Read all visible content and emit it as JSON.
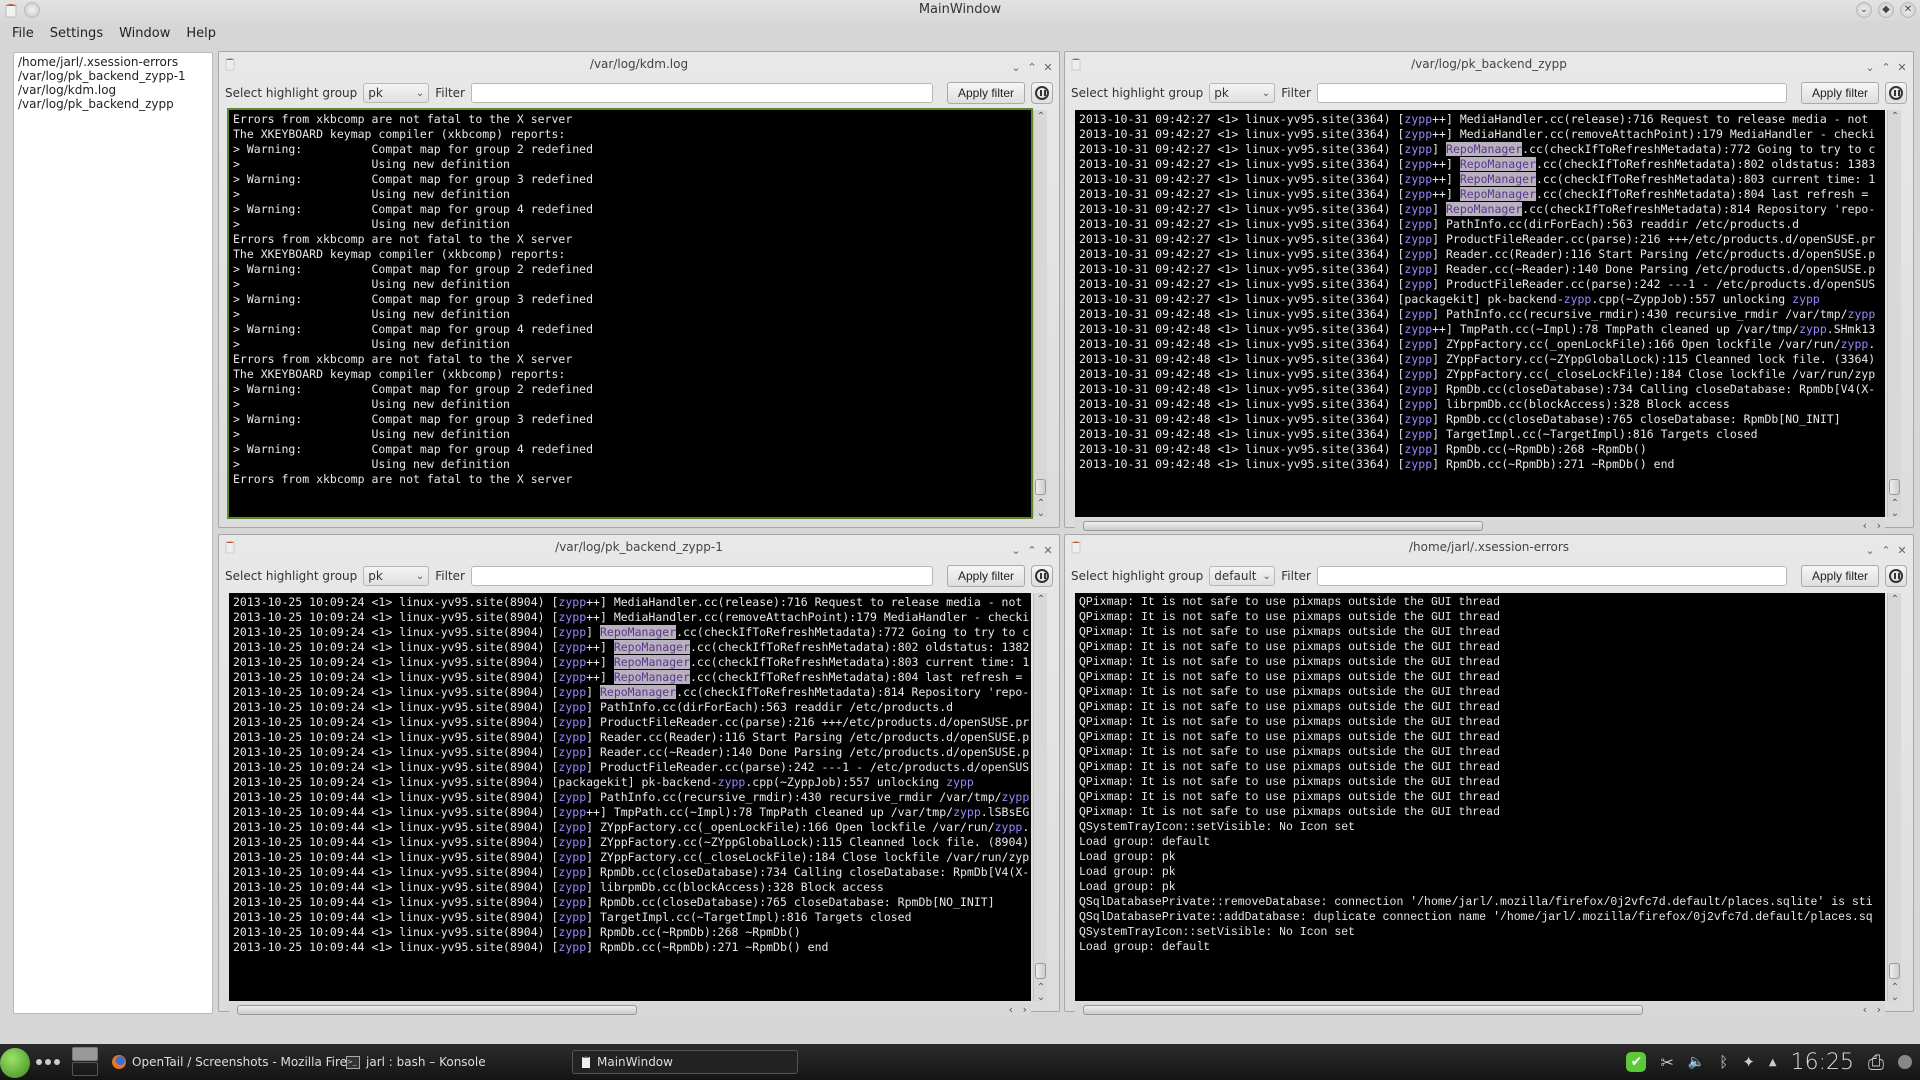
{
  "window": {
    "title": "MainWindow"
  },
  "menu": [
    "File",
    "Settings",
    "Window",
    "Help"
  ],
  "files": [
    "/home/jarl/.xsession-errors",
    "/var/log/pk_backend_zypp-1",
    "/var/log/kdm.log",
    "/var/log/pk_backend_zypp"
  ],
  "common": {
    "highlight_label": "Select highlight group",
    "filter_label": "Filter",
    "apply_label": "Apply filter",
    "filter_value": ""
  },
  "panels": [
    {
      "title": "/var/log/kdm.log",
      "highlight_group": "pk",
      "lines": [
        "Errors from xkbcomp are not fatal to the X server",
        "The XKEYBOARD keymap compiler (xkbcomp) reports:",
        "> Warning:          Compat map for group 2 redefined",
        ">                   Using new definition",
        "> Warning:          Compat map for group 3 redefined",
        ">                   Using new definition",
        "> Warning:          Compat map for group 4 redefined",
        ">                   Using new definition",
        "Errors from xkbcomp are not fatal to the X server",
        "The XKEYBOARD keymap compiler (xkbcomp) reports:",
        "> Warning:          Compat map for group 2 redefined",
        ">                   Using new definition",
        "> Warning:          Compat map for group 3 redefined",
        ">                   Using new definition",
        "> Warning:          Compat map for group 4 redefined",
        ">                   Using new definition",
        "Errors from xkbcomp are not fatal to the X server",
        "The XKEYBOARD keymap compiler (xkbcomp) reports:",
        "> Warning:          Compat map for group 2 redefined",
        ">                   Using new definition",
        "> Warning:          Compat map for group 3 redefined",
        ">                   Using new definition",
        "> Warning:          Compat map for group 4 redefined",
        ">                   Using new definition",
        "Errors from xkbcomp are not fatal to the X server"
      ]
    },
    {
      "title": "/var/log/pk_backend_zypp",
      "highlight_group": "pk",
      "lines": [
        "2013-10-31 09:42:27 <1> linux-yv95.site(3364) [zypp++] MediaHandler.cc(release):716 Request to release media - not",
        "2013-10-31 09:42:27 <1> linux-yv95.site(3364) [zypp++] MediaHandler.cc(removeAttachPoint):179 MediaHandler - checki",
        "2013-10-31 09:42:27 <1> linux-yv95.site(3364) [zypp] RepoManager.cc(checkIfToRefreshMetadata):772 Going to try to c",
        "2013-10-31 09:42:27 <1> linux-yv95.site(3364) [zypp++] RepoManager.cc(checkIfToRefreshMetadata):802 oldstatus: 1383",
        "2013-10-31 09:42:27 <1> linux-yv95.site(3364) [zypp++] RepoManager.cc(checkIfToRefreshMetadata):803 current time: 1",
        "2013-10-31 09:42:27 <1> linux-yv95.site(3364) [zypp++] RepoManager.cc(checkIfToRefreshMetadata):804 last refresh =",
        "2013-10-31 09:42:27 <1> linux-yv95.site(3364) [zypp] RepoManager.cc(checkIfToRefreshMetadata):814 Repository 'repo-",
        "2013-10-31 09:42:27 <1> linux-yv95.site(3364) [zypp] PathInfo.cc(dirForEach):563 readdir /etc/products.d",
        "2013-10-31 09:42:27 <1> linux-yv95.site(3364) [zypp] ProductFileReader.cc(parse):216 +++/etc/products.d/openSUSE.pr",
        "2013-10-31 09:42:27 <1> linux-yv95.site(3364) [zypp] Reader.cc(Reader):116 Start Parsing /etc/products.d/openSUSE.p",
        "2013-10-31 09:42:27 <1> linux-yv95.site(3364) [zypp] Reader.cc(~Reader):140 Done Parsing /etc/products.d/openSUSE.p",
        "2013-10-31 09:42:27 <1> linux-yv95.site(3364) [zypp] ProductFileReader.cc(parse):242 ---1 - /etc/products.d/openSUS",
        "2013-10-31 09:42:27 <1> linux-yv95.site(3364) [packagekit] pk-backend-zypp.cpp(~ZyppJob):557 unlocking zypp",
        "2013-10-31 09:42:48 <1> linux-yv95.site(3364) [zypp] PathInfo.cc(recursive_rmdir):430 recursive_rmdir /var/tmp/zypp",
        "2013-10-31 09:42:48 <1> linux-yv95.site(3364) [zypp++] TmpPath.cc(~Impl):78 TmpPath cleaned up /var/tmp/zypp.SHmk13",
        "2013-10-31 09:42:48 <1> linux-yv95.site(3364) [zypp] ZYppFactory.cc(_openLockFile):166 Open lockfile /var/run/zypp.",
        "2013-10-31 09:42:48 <1> linux-yv95.site(3364) [zypp] ZYppFactory.cc(~ZYppGlobalLock):115 Cleanned lock file. (3364)",
        "2013-10-31 09:42:48 <1> linux-yv95.site(3364) [zypp] ZYppFactory.cc(_closeLockFile):184 Close lockfile /var/run/zyp",
        "2013-10-31 09:42:48 <1> linux-yv95.site(3364) [zypp] RpmDb.cc(closeDatabase):734 Calling closeDatabase: RpmDb[V4(X-",
        "2013-10-31 09:42:48 <1> linux-yv95.site(3364) [zypp] librpmDb.cc(blockAccess):328 Block access",
        "2013-10-31 09:42:48 <1> linux-yv95.site(3364) [zypp] RpmDb.cc(closeDatabase):765 closeDatabase: RpmDb[NO_INIT]",
        "2013-10-31 09:42:48 <1> linux-yv95.site(3364) [zypp] TargetImpl.cc(~TargetImpl):816 Targets closed",
        "2013-10-31 09:42:48 <1> linux-yv95.site(3364) [zypp] RpmDb.cc(~RpmDb):268 ~RpmDb()",
        "2013-10-31 09:42:48 <1> linux-yv95.site(3364) [zypp] RpmDb.cc(~RpmDb):271 ~RpmDb() end"
      ]
    },
    {
      "title": "/var/log/pk_backend_zypp-1",
      "highlight_group": "pk",
      "lines": [
        "2013-10-25 10:09:24 <1> linux-yv95.site(8904) [zypp++] MediaHandler.cc(release):716 Request to release media - not",
        "2013-10-25 10:09:24 <1> linux-yv95.site(8904) [zypp++] MediaHandler.cc(removeAttachPoint):179 MediaHandler - checki",
        "2013-10-25 10:09:24 <1> linux-yv95.site(8904) [zypp] RepoManager.cc(checkIfToRefreshMetadata):772 Going to try to c",
        "2013-10-25 10:09:24 <1> linux-yv95.site(8904) [zypp++] RepoManager.cc(checkIfToRefreshMetadata):802 oldstatus: 1382",
        "2013-10-25 10:09:24 <1> linux-yv95.site(8904) [zypp++] RepoManager.cc(checkIfToRefreshMetadata):803 current time: 1",
        "2013-10-25 10:09:24 <1> linux-yv95.site(8904) [zypp++] RepoManager.cc(checkIfToRefreshMetadata):804 last refresh =",
        "2013-10-25 10:09:24 <1> linux-yv95.site(8904) [zypp] RepoManager.cc(checkIfToRefreshMetadata):814 Repository 'repo-",
        "2013-10-25 10:09:24 <1> linux-yv95.site(8904) [zypp] PathInfo.cc(dirForEach):563 readdir /etc/products.d",
        "2013-10-25 10:09:24 <1> linux-yv95.site(8904) [zypp] ProductFileReader.cc(parse):216 +++/etc/products.d/openSUSE.pr",
        "2013-10-25 10:09:24 <1> linux-yv95.site(8904) [zypp] Reader.cc(Reader):116 Start Parsing /etc/products.d/openSUSE.p",
        "2013-10-25 10:09:24 <1> linux-yv95.site(8904) [zypp] Reader.cc(~Reader):140 Done Parsing /etc/products.d/openSUSE.p",
        "2013-10-25 10:09:24 <1> linux-yv95.site(8904) [zypp] ProductFileReader.cc(parse):242 ---1 - /etc/products.d/openSUS",
        "2013-10-25 10:09:24 <1> linux-yv95.site(8904) [packagekit] pk-backend-zypp.cpp(~ZyppJob):557 unlocking zypp",
        "2013-10-25 10:09:44 <1> linux-yv95.site(8904) [zypp] PathInfo.cc(recursive_rmdir):430 recursive_rmdir /var/tmp/zypp",
        "2013-10-25 10:09:44 <1> linux-yv95.site(8904) [zypp++] TmpPath.cc(~Impl):78 TmpPath cleaned up /var/tmp/zypp.lSBsEG",
        "2013-10-25 10:09:44 <1> linux-yv95.site(8904) [zypp] ZYppFactory.cc(_openLockFile):166 Open lockfile /var/run/zypp.",
        "2013-10-25 10:09:44 <1> linux-yv95.site(8904) [zypp] ZYppFactory.cc(~ZYppGlobalLock):115 Cleanned lock file. (8904)",
        "2013-10-25 10:09:44 <1> linux-yv95.site(8904) [zypp] ZYppFactory.cc(_closeLockFile):184 Close lockfile /var/run/zyp",
        "2013-10-25 10:09:44 <1> linux-yv95.site(8904) [zypp] RpmDb.cc(closeDatabase):734 Calling closeDatabase: RpmDb[V4(X-",
        "2013-10-25 10:09:44 <1> linux-yv95.site(8904) [zypp] librpmDb.cc(blockAccess):328 Block access",
        "2013-10-25 10:09:44 <1> linux-yv95.site(8904) [zypp] RpmDb.cc(closeDatabase):765 closeDatabase: RpmDb[NO_INIT]",
        "2013-10-25 10:09:44 <1> linux-yv95.site(8904) [zypp] TargetImpl.cc(~TargetImpl):816 Targets closed",
        "2013-10-25 10:09:44 <1> linux-yv95.site(8904) [zypp] RpmDb.cc(~RpmDb):268 ~RpmDb()",
        "2013-10-25 10:09:44 <1> linux-yv95.site(8904) [zypp] RpmDb.cc(~RpmDb):271 ~RpmDb() end"
      ]
    },
    {
      "title": "/home/jarl/.xsession-errors",
      "highlight_group": "default",
      "lines": [
        "QPixmap: It is not safe to use pixmaps outside the GUI thread",
        "QPixmap: It is not safe to use pixmaps outside the GUI thread",
        "QPixmap: It is not safe to use pixmaps outside the GUI thread",
        "QPixmap: It is not safe to use pixmaps outside the GUI thread",
        "QPixmap: It is not safe to use pixmaps outside the GUI thread",
        "QPixmap: It is not safe to use pixmaps outside the GUI thread",
        "QPixmap: It is not safe to use pixmaps outside the GUI thread",
        "QPixmap: It is not safe to use pixmaps outside the GUI thread",
        "QPixmap: It is not safe to use pixmaps outside the GUI thread",
        "QPixmap: It is not safe to use pixmaps outside the GUI thread",
        "QPixmap: It is not safe to use pixmaps outside the GUI thread",
        "QPixmap: It is not safe to use pixmaps outside the GUI thread",
        "QPixmap: It is not safe to use pixmaps outside the GUI thread",
        "QPixmap: It is not safe to use pixmaps outside the GUI thread",
        "QPixmap: It is not safe to use pixmaps outside the GUI thread",
        "QSystemTrayIcon::setVisible: No Icon set",
        "Load group: default",
        "Load group: pk",
        "Load group: pk",
        "Load group: pk",
        "QSqlDatabasePrivate::removeDatabase: connection '/home/jarl/.mozilla/firefox/0j2vfc7d.default/places.sqlite' is sti",
        "QSqlDatabasePrivate::addDatabase: duplicate connection name '/home/jarl/.mozilla/firefox/0j2vfc7d.default/places.sq",
        "QSystemTrayIcon::setVisible: No Icon set",
        "Load group: default"
      ]
    }
  ],
  "highlight": {
    "keyword": "zypp",
    "keyword_color": "#9a86ff",
    "match": "RepoManager",
    "match_bg": "#b9b0c0",
    "match_fg": "#5a3a8a"
  },
  "taskbar": {
    "tasks": [
      "OpenTail / Screenshots - Mozilla Fire",
      "jarl : bash – Konsole",
      "MainWindow"
    ],
    "clock": "16:25"
  }
}
